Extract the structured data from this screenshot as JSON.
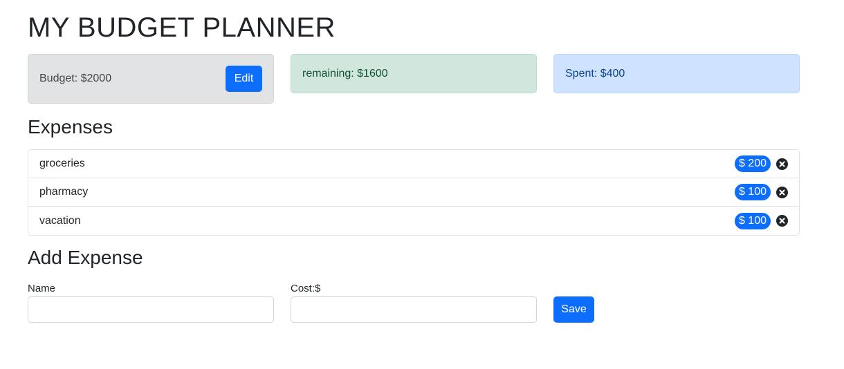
{
  "header": {
    "title": "MY BUDGET PLANNER"
  },
  "cards": {
    "budget": {
      "text": "Budget: $2000",
      "edit_label": "Edit"
    },
    "remaining": {
      "text": "remaining: $1600"
    },
    "spent": {
      "text": "Spent: $400"
    }
  },
  "expenses": {
    "heading": "Expenses",
    "items": [
      {
        "name": "groceries",
        "cost": "$ 200"
      },
      {
        "name": "pharmacy",
        "cost": "$ 100"
      },
      {
        "name": "vacation",
        "cost": "$ 100"
      }
    ]
  },
  "add_expense": {
    "heading": "Add Expense",
    "name_label": "Name",
    "name_value": "",
    "cost_label": "Cost:$",
    "cost_value": "",
    "save_label": "Save"
  },
  "colors": {
    "primary": "#0d6efd",
    "budget_bg": "#e2e3e5",
    "remaining_bg": "#d1e7dd",
    "spent_bg": "#cfe2ff"
  },
  "icons": {
    "delete": "times-circle-icon"
  }
}
